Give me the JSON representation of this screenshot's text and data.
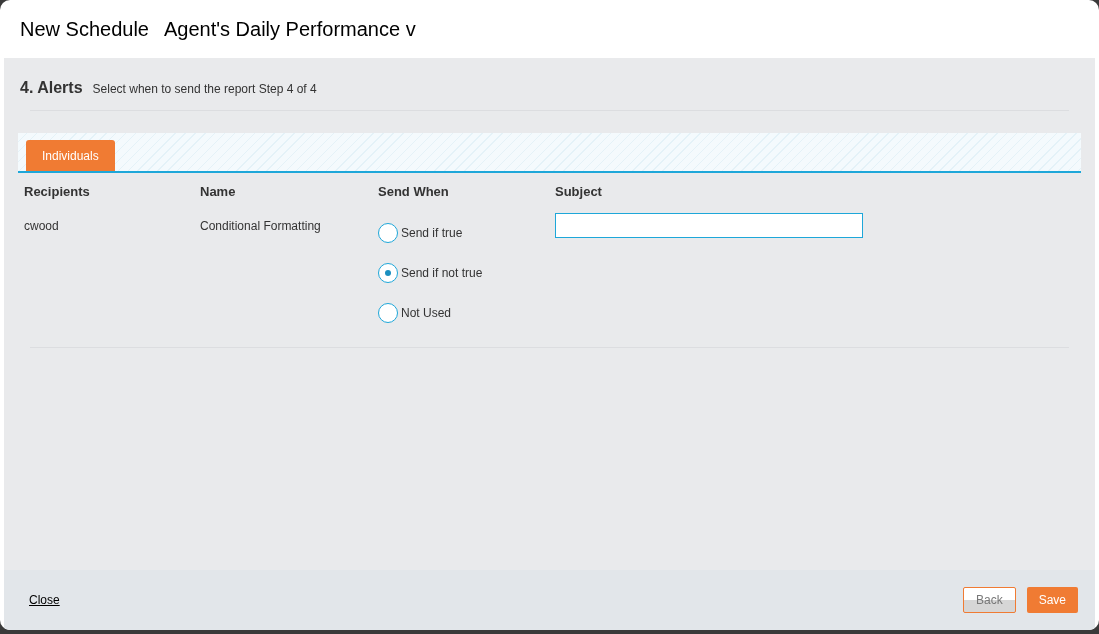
{
  "dialog": {
    "title": "New Schedule",
    "report_name": "Agent's Daily Performance v"
  },
  "step": {
    "heading": "4. Alerts",
    "description": "Select when to send the report Step 4 of 4"
  },
  "tabs": [
    {
      "label": "Individuals",
      "selected": true
    }
  ],
  "table": {
    "columns": [
      "Recipients",
      "Name",
      "Send When",
      "Subject"
    ],
    "rows": [
      {
        "recipient": "cwood",
        "name": "Conditional Formatting",
        "send_when": [
          {
            "label": "Send if true",
            "selected": false
          },
          {
            "label": "Send if not true",
            "selected": true
          },
          {
            "label": "Not Used",
            "selected": false
          }
        ]
      }
    ]
  },
  "footer": {
    "close": "Close",
    "buttons": [
      {
        "label": "Back",
        "kind": "secondary"
      },
      {
        "label": "Save",
        "kind": "primary"
      }
    ]
  }
}
